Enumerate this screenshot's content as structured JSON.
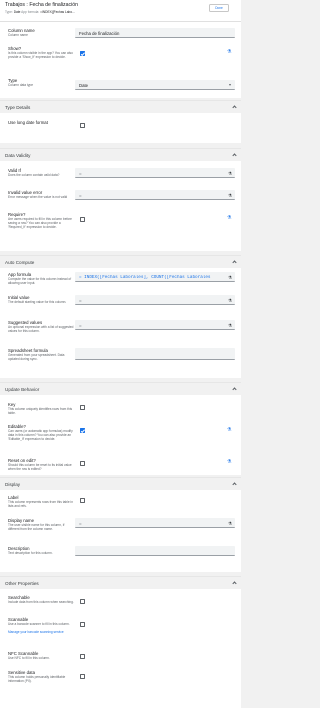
{
  "header": {
    "title": "Trabajos : Fecha de finalización",
    "type_label": "Type:",
    "type_value": "Date",
    "app_formula_label": "App formula:",
    "app_formula_value": "=INDEX([Fechas Labo...",
    "done_label": "Done"
  },
  "general": {
    "column_name": {
      "label": "Column name",
      "desc": "Column name",
      "value": "Fecha de finalización"
    },
    "show": {
      "label": "Show?",
      "desc": "Is this column visible in the app? You can also provide a 'Show_If' expression to decide.",
      "checked": true
    },
    "type": {
      "label": "Type",
      "desc": "Column data type",
      "value": "Date"
    }
  },
  "sections": {
    "type_details": "Type Details",
    "data_validity": "Data Validity",
    "auto_compute": "Auto Compute",
    "update_behavior": "Update Behavior",
    "display": "Display",
    "other_properties": "Other Properties"
  },
  "type_details": {
    "use_long_date": {
      "label": "Use long date format",
      "checked": false
    }
  },
  "data_validity": {
    "valid_if": {
      "label": "Valid If",
      "desc": "Does the column contain valid data?",
      "value": "="
    },
    "invalid_value_error": {
      "label": "Invalid value error",
      "desc": "Error message when the value is not valid",
      "value": "="
    },
    "require": {
      "label": "Require?",
      "desc": "Are users required to fill in this column before saving a row? You can also provide a 'Required_If' expression to decide.",
      "checked": false
    }
  },
  "auto_compute": {
    "app_formula": {
      "label": "App formula",
      "desc": "Compute the value for this column instead of allowing user input.",
      "value": "= INDEX([Fechas Laborales], COUNT([Fechas Laborales"
    },
    "initial_value": {
      "label": "Initial value",
      "desc": "The default starting value for this column.",
      "value": "="
    },
    "suggested_values": {
      "label": "Suggested values",
      "desc": "An optional expression with a list of suggested values for this column.",
      "value": "="
    },
    "spreadsheet_formula": {
      "label": "Spreadsheet formula",
      "desc": "Generated from your spreadsheet. Data updated during sync."
    }
  },
  "update_behavior": {
    "key": {
      "label": "Key",
      "desc": "This column uniquely identifies rows from this table.",
      "checked": false
    },
    "editable": {
      "label": "Editable?",
      "desc": "Can users (or automatic app formulas) modify data in this column? You can also provide an 'Editable_If' expression to decide.",
      "checked": true
    },
    "reset_on_edit": {
      "label": "Reset on edit?",
      "desc": "Should this column be reset to its initial value when the row is edited?",
      "checked": false
    }
  },
  "display": {
    "label": {
      "label": "Label",
      "desc": "This column represents rows from this table in lists and refs.",
      "checked": false
    },
    "display_name": {
      "label": "Display name",
      "desc": "The user-visible name for this column, if different from the column name.",
      "value": "="
    },
    "description": {
      "label": "Description",
      "desc": "Text description for this column.",
      "value": ""
    }
  },
  "other_properties": {
    "searchable": {
      "label": "Searchable",
      "desc": "Include data from this column when searching.",
      "checked": false
    },
    "scannable": {
      "label": "Scannable",
      "desc": "Use a barcode scanner to fill in this column.",
      "link": "Manage your barcode scanning service",
      "checked": false
    },
    "nfc_scannable": {
      "label": "NFC Scannable",
      "desc": "Use NFC to fill in this column.",
      "checked": false
    },
    "sensitive_data": {
      "label": "Sensitive data",
      "desc": "This column holds personally identifiable information (PII).",
      "checked": false
    }
  },
  "icons": {
    "formula": "flask-icon",
    "chevron": "chevron-up-icon"
  },
  "colors": {
    "accent": "#1a73e8",
    "panel": "#ffffff",
    "background": "#f1f1f1"
  }
}
